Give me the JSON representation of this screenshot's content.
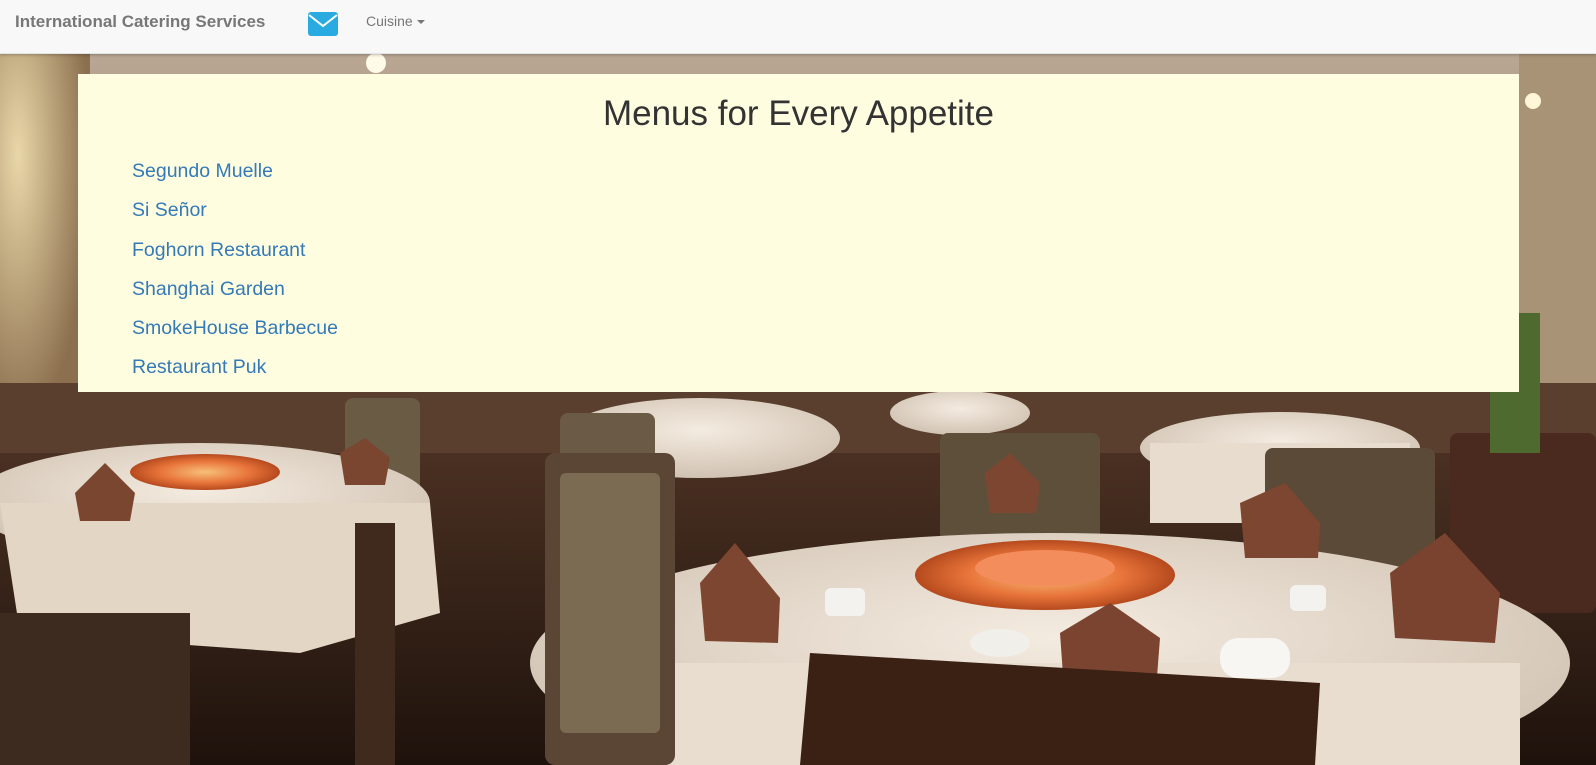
{
  "navbar": {
    "brand": "International Catering Services",
    "mail_icon": "envelope-icon",
    "mail_color": "#29abe2",
    "dropdown_label": "Cuisine"
  },
  "main": {
    "title": "Menus for Every Appetite",
    "restaurants": [
      "Segundo Muelle",
      "Si Señor",
      "Foghorn Restaurant",
      "Shanghai Garden",
      "SmokeHouse Barbecue",
      "Restaurant Puk"
    ]
  },
  "theme": {
    "panel_background": "#fffde0",
    "link_color": "#337ab7",
    "navbar_background": "#f8f8f8"
  }
}
